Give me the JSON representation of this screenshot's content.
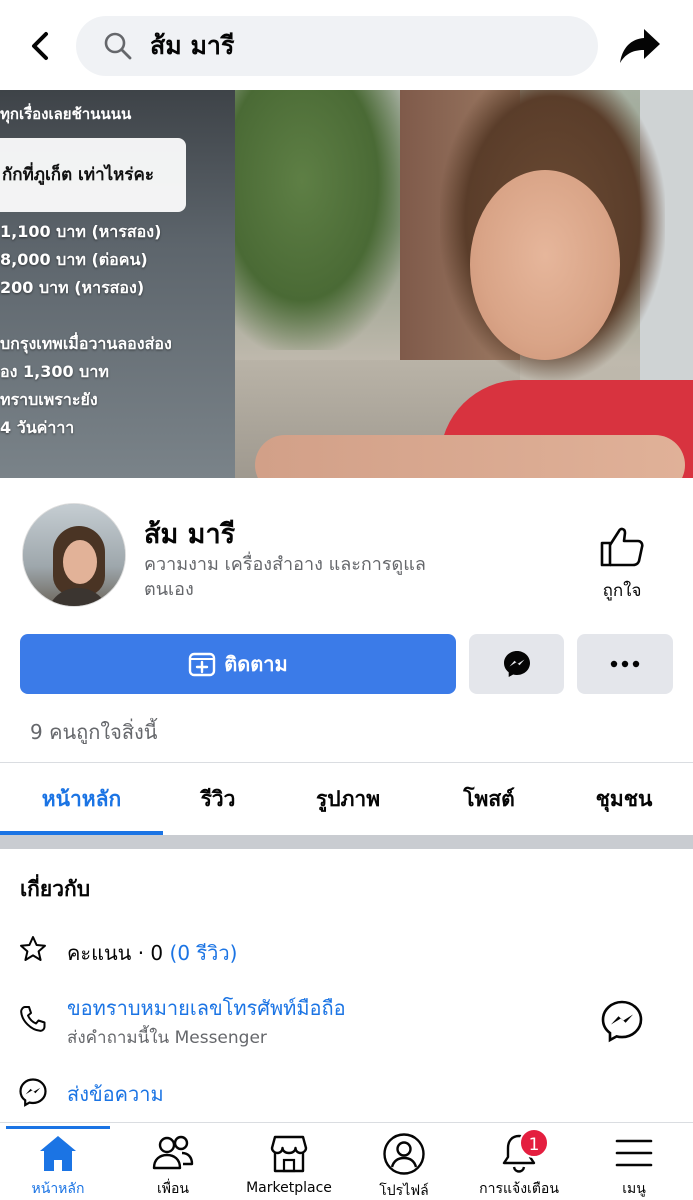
{
  "header": {
    "search_query": "ส้ม มารี"
  },
  "cover": {
    "sign_top": "ทุกเรื่องเลยช้านนนน",
    "sign_card": "กักที่ภูเก็ต เท่าไหร่คะ",
    "sign_lines": [
      "1,100 บาท (หารสอง)",
      "8,000 บาท (ต่อคน)",
      "200 บาท (หารสอง)",
      "",
      "บกรุงเทพเมื่อวานลองส่อง",
      "อง 1,300 บาท",
      "ทราบเพราะยัง",
      "4 วันค่าาา"
    ]
  },
  "profile": {
    "name": "ส้ม มารี",
    "category": "ความงาม เครื่องสำอาง และการดูแลตนเอง",
    "like_label": "ถูกใจ",
    "follow_label": "ติดตาม",
    "likes_count": "9 คนถูกใจสิ่งนี้"
  },
  "tabs": [
    {
      "label": "หน้าหลัก",
      "active": true
    },
    {
      "label": "รีวิว",
      "active": false
    },
    {
      "label": "รูปภาพ",
      "active": false
    },
    {
      "label": "โพสต์",
      "active": false
    },
    {
      "label": "ชุมชน",
      "active": false
    }
  ],
  "about": {
    "title": "เกี่ยวกับ",
    "rating_label": "คะแนน · 0",
    "rating_reviews": "(0 รีวิว)",
    "phone_title": "ขอทราบหมายเลขโทรศัพท์มือถือ",
    "phone_sub": "ส่งคำถามนี้ใน Messenger",
    "send_message": "ส่งข้อความ"
  },
  "bottom_nav": [
    {
      "label": "หน้าหลัก",
      "icon": "home-icon",
      "active": true
    },
    {
      "label": "เพื่อน",
      "icon": "friends-icon",
      "active": false
    },
    {
      "label": "Marketplace",
      "icon": "marketplace-icon",
      "active": false
    },
    {
      "label": "โปรไฟล์",
      "icon": "profile-icon",
      "active": false
    },
    {
      "label": "การแจ้งเตือน",
      "icon": "bell-icon",
      "active": false,
      "badge": "1"
    },
    {
      "label": "เมนู",
      "icon": "menu-icon",
      "active": false
    }
  ],
  "colors": {
    "accent": "#1b74e4",
    "follow_button": "#3b7be8",
    "badge": "#e41e3f"
  }
}
